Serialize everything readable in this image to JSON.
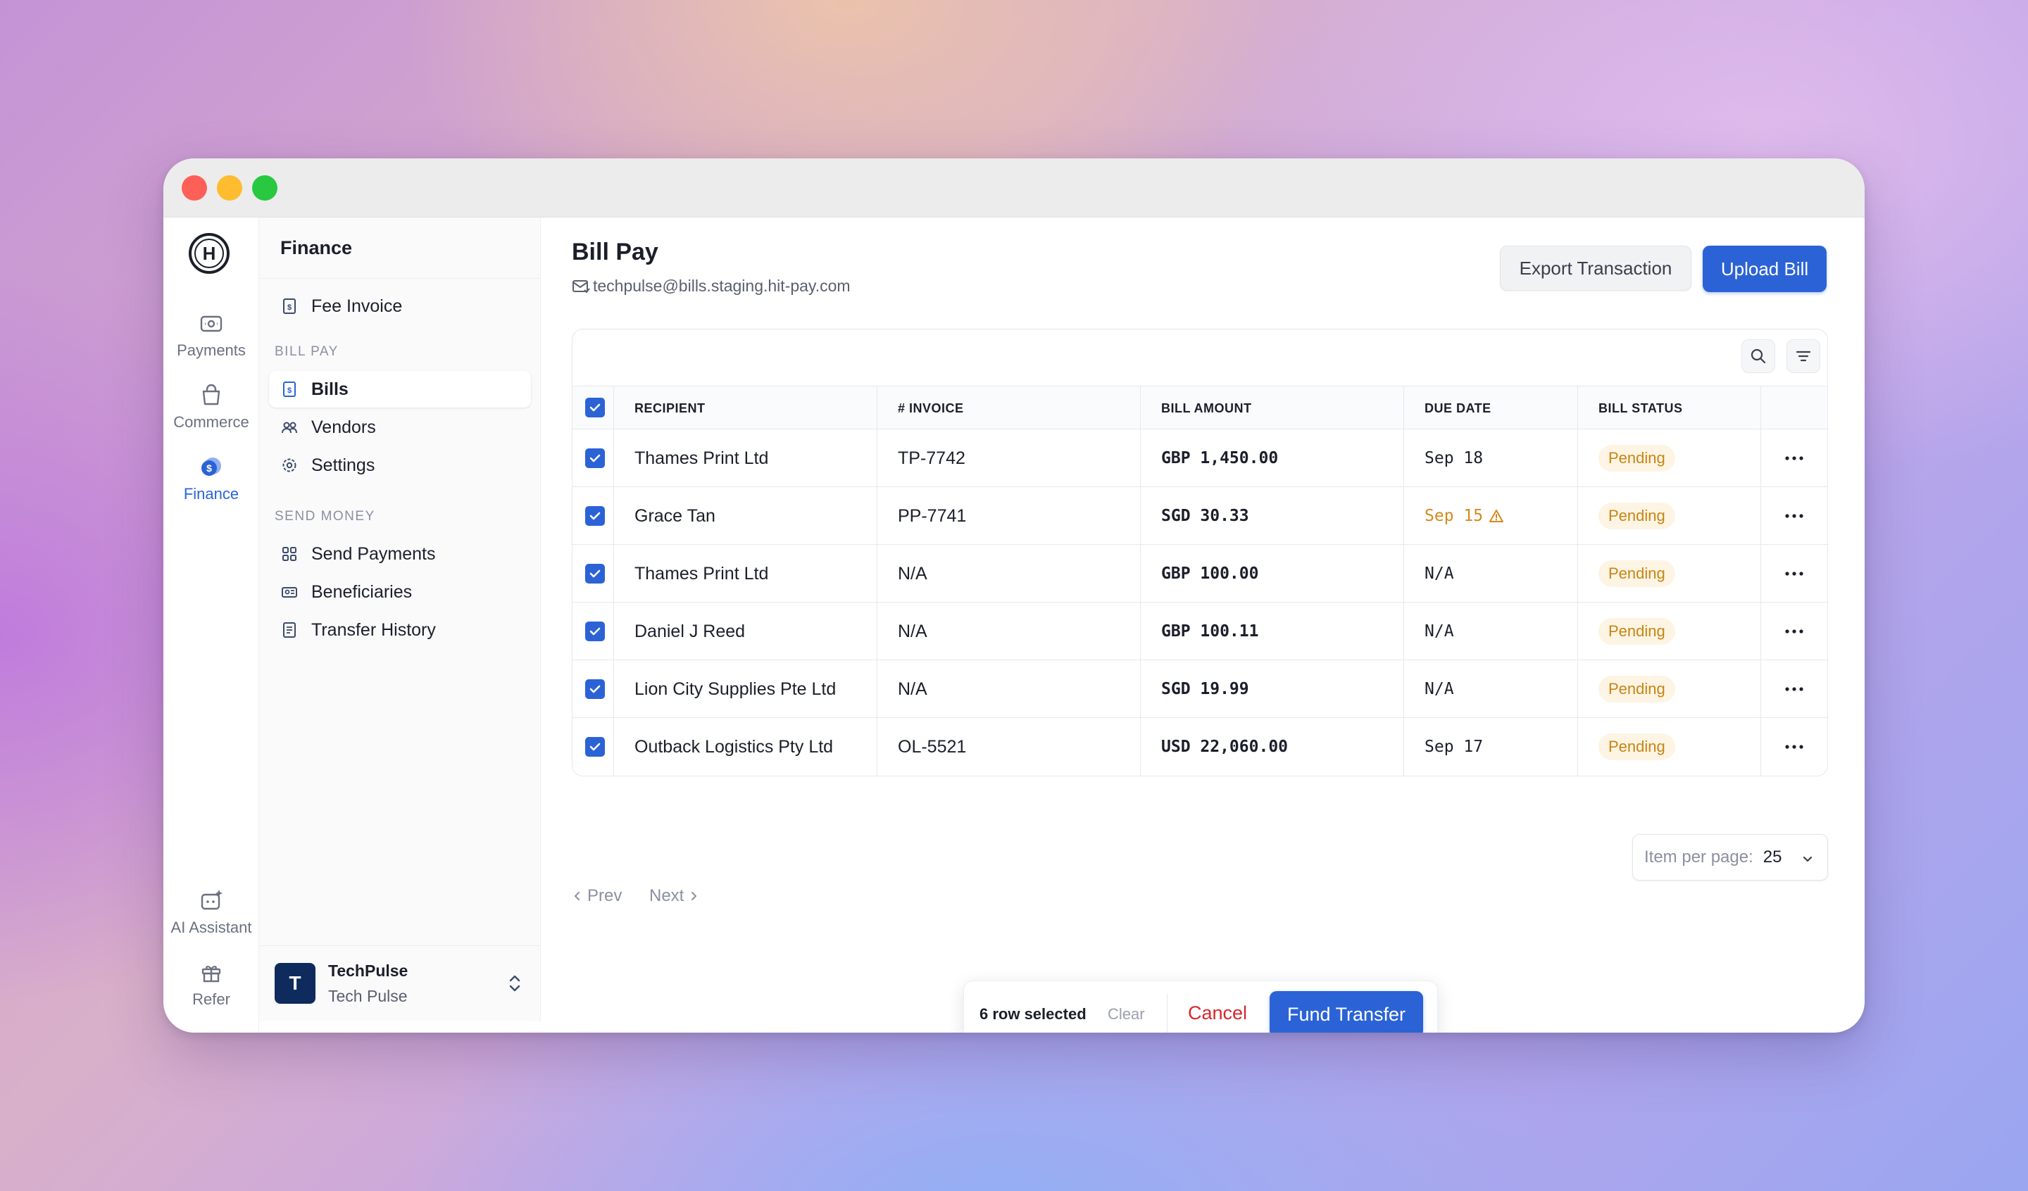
{
  "rail": {
    "logo_letter": "H",
    "items": [
      {
        "label": "Payments",
        "icon": "payments-icon"
      },
      {
        "label": "Commerce",
        "icon": "shopping-bag-icon"
      },
      {
        "label": "Finance",
        "icon": "finance-icon",
        "active": true
      },
      {
        "label": "AI Assistant",
        "icon": "ai-assistant-icon"
      },
      {
        "label": "Refer",
        "icon": "gift-icon"
      }
    ]
  },
  "sidebar": {
    "title": "Finance",
    "items": [
      {
        "label": "Fee Invoice",
        "icon": "invoice-icon"
      },
      {
        "label": "Bills",
        "icon": "bill-icon",
        "active": true
      },
      {
        "label": "Vendors",
        "icon": "vendors-icon"
      },
      {
        "label": "Settings",
        "icon": "settings-icon"
      },
      {
        "label": "Send Payments",
        "icon": "grid-icon"
      },
      {
        "label": "Beneficiaries",
        "icon": "beneficiaries-icon"
      },
      {
        "label": "Transfer History",
        "icon": "history-doc-icon"
      }
    ],
    "sections": {
      "bill_pay": "BILL PAY",
      "send_money": "SEND MONEY"
    },
    "account": {
      "initial": "T",
      "name": "TechPulse",
      "subtitle": "Tech Pulse"
    }
  },
  "page": {
    "title": "Bill Pay",
    "email": "techpulse@bills.staging.hit-pay.com",
    "export_label": "Export Transaction",
    "upload_label": "Upload Bill"
  },
  "table": {
    "columns": [
      "RECIPIENT",
      "# INVOICE",
      "BILL AMOUNT",
      "DUE DATE",
      "BILL STATUS"
    ],
    "rows": [
      {
        "recipient": "Thames Print Ltd",
        "invoice": "TP-7742",
        "amount": "GBP 1,450.00",
        "due": "Sep 18",
        "status": "Pending",
        "overdue": false,
        "selected": true
      },
      {
        "recipient": "Grace Tan",
        "invoice": "PP-7741",
        "amount": "SGD 30.33",
        "due": "Sep 15",
        "status": "Pending",
        "overdue": true,
        "selected": true
      },
      {
        "recipient": "Thames Print Ltd",
        "invoice": "N/A",
        "amount": "GBP 100.00",
        "due": "N/A",
        "status": "Pending",
        "overdue": false,
        "selected": true
      },
      {
        "recipient": "Daniel J Reed",
        "invoice": "N/A",
        "amount": "GBP 100.11",
        "due": "N/A",
        "status": "Pending",
        "overdue": false,
        "selected": true
      },
      {
        "recipient": "Lion City Supplies Pte Ltd",
        "invoice": "N/A",
        "amount": "SGD 19.99",
        "due": "N/A",
        "status": "Pending",
        "overdue": false,
        "selected": true
      },
      {
        "recipient": "Outback Logistics Pty Ltd",
        "invoice": "OL-5521",
        "amount": "USD 22,060.00",
        "due": "Sep 17",
        "status": "Pending",
        "overdue": false,
        "selected": true
      }
    ]
  },
  "pagination": {
    "prev_label": "Prev",
    "next_label": "Next",
    "per_page_label": "Item per page:",
    "per_page_value": "25"
  },
  "action_bar": {
    "count_label": "6 row selected",
    "clear_label": "Clear",
    "cancel_label": "Cancel",
    "fund_label": "Fund Transfer"
  },
  "colors": {
    "accent": "#2b63d6",
    "pending_badge_bg": "#fdf4e3",
    "pending_badge_text": "#c78514",
    "cancel_text": "#d8262c"
  }
}
